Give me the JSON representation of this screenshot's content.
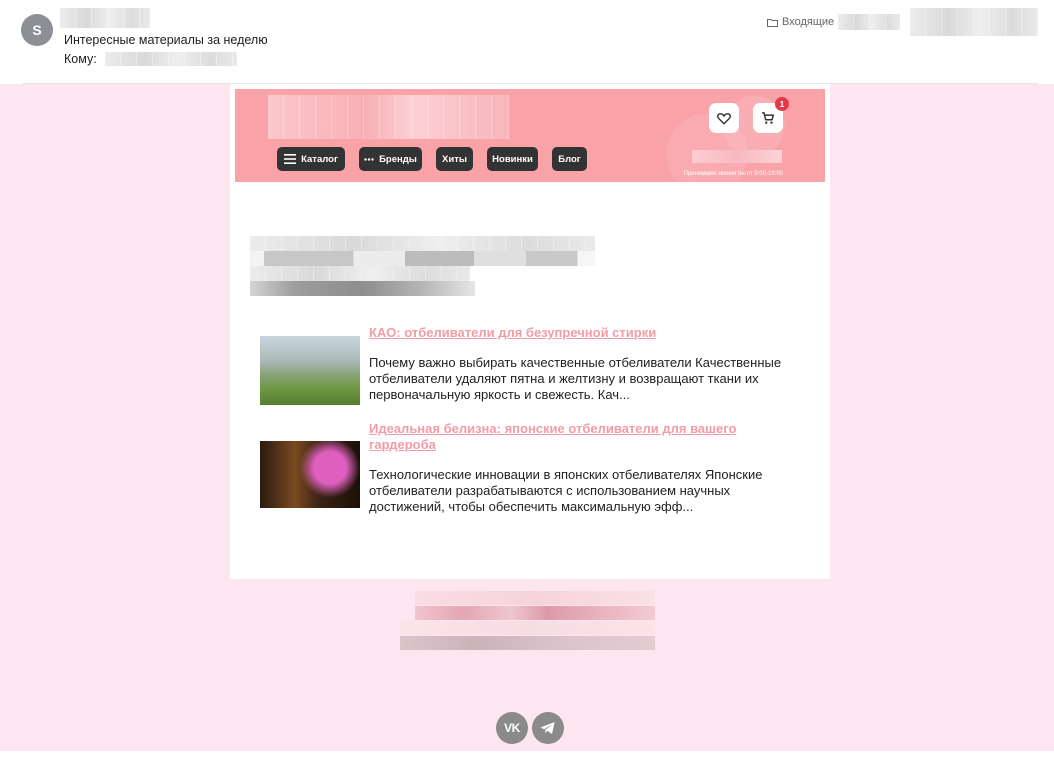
{
  "header": {
    "avatar_letter": "S",
    "subject": "Интересные материалы за неделю",
    "to_label": "Кому:",
    "folder": "Входящие",
    "icons": {
      "folder": "folder-icon"
    }
  },
  "banner": {
    "cart_count": "1",
    "nav": [
      {
        "label": "Каталог",
        "icon": "menu-icon"
      },
      {
        "label": "Бренды",
        "icon": "dots-icon"
      },
      {
        "label": "Хиты"
      },
      {
        "label": "Новинки"
      },
      {
        "label": "Блог"
      }
    ],
    "call_hours": "Принимаем звонки пн-пт 9:00-19:00",
    "icons": {
      "favorite": "heart-icon",
      "cart": "cart-icon"
    },
    "colors": {
      "background": "#f9a2a8",
      "nav_button": "#333333",
      "badge": "#e13b4b"
    }
  },
  "articles": [
    {
      "title": "КАО: отбеливатели для безупречной стирки",
      "excerpt": "Почему важно выбирать качественные отбеливатели Качественные отбеливатели удаляют пятна и желтизну и возвращают ткани их первоначальную яркость и свежесть. Кач..."
    },
    {
      "title": "Идеальная белизна: японские отбеливатели для вашего гардероба",
      "excerpt": "Технологические инновации в японских отбеливателях Японские отбеливатели разрабатываются с использованием научных достижений, чтобы обеспечить максимальную эфф..."
    }
  ],
  "footer": {
    "social": [
      {
        "name": "vk",
        "label": "VK",
        "icon": "vk-icon"
      },
      {
        "name": "telegram",
        "icon": "telegram-icon"
      }
    ]
  },
  "colors": {
    "email_background": "#fde6ef",
    "link": "#f29ca6",
    "social": "#8a8a8a"
  }
}
